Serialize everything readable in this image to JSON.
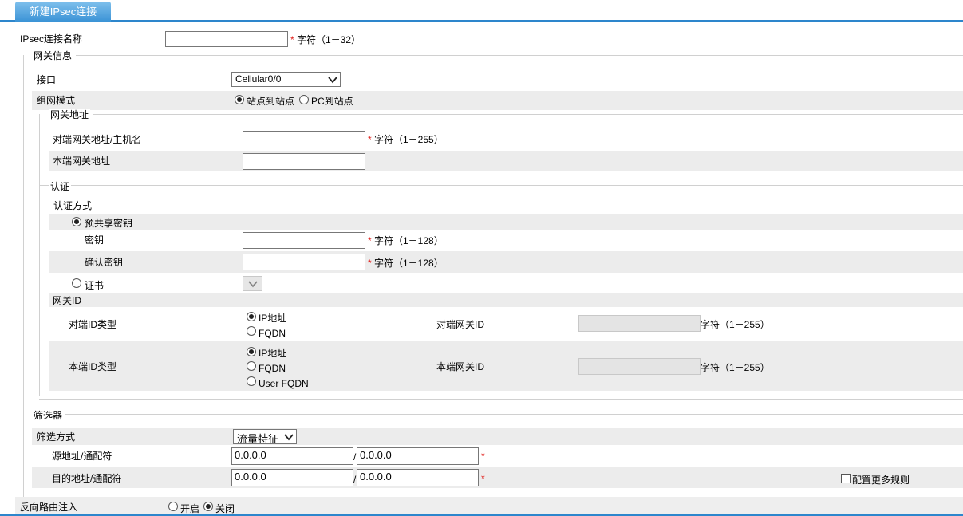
{
  "tab": {
    "title": "新建IPsec连接"
  },
  "connection_name": {
    "label": "IPsec连接名称",
    "hint": "字符（1－32）",
    "value": ""
  },
  "gateway": {
    "legend": "网关信息",
    "interface_label": "接口",
    "interface_value": "Cellular0/0",
    "mode_label": "组网模式",
    "mode_options": [
      "站点到站点",
      "PC到站点"
    ],
    "address": {
      "legend": "网关地址",
      "peer_label": "对端网关地址/主机名",
      "peer_hint": "字符（1－255）",
      "local_label": "本端网关地址"
    }
  },
  "auth": {
    "legend": "认证",
    "method_label": "认证方式",
    "psk_label": "预共享密钥",
    "key_label": "密钥",
    "key_hint": "字符（1－128）",
    "confirm_label": "确认密钥",
    "confirm_hint": "字符（1－128）",
    "cert_label": "证书",
    "gwid_label": "网关ID",
    "peer_id_type_label": "对端ID类型",
    "peer_id_options": [
      "IP地址",
      "FQDN"
    ],
    "peer_gw_id_label": "对端网关ID",
    "peer_gw_id_hint": "字符（1－255）",
    "local_id_type_label": "本端ID类型",
    "local_id_options": [
      "IP地址",
      "FQDN",
      "User FQDN"
    ],
    "local_gw_id_label": "本端网关ID",
    "local_gw_id_hint": "字符（1－255）"
  },
  "filter": {
    "legend": "筛选器",
    "method_label": "筛选方式",
    "method_value": "流量特征",
    "src_label": "源地址/通配符",
    "src_addr": "0.0.0.0",
    "src_wild": "0.0.0.0",
    "dst_label": "目的地址/通配符",
    "dst_addr": "0.0.0.0",
    "dst_wild": "0.0.0.0",
    "more_rules_label": "配置更多规则"
  },
  "reverse_route": {
    "label": "反向路由注入",
    "options": [
      "开启",
      "关闭"
    ]
  },
  "symbols": {
    "required": "*",
    "slash": "/"
  }
}
